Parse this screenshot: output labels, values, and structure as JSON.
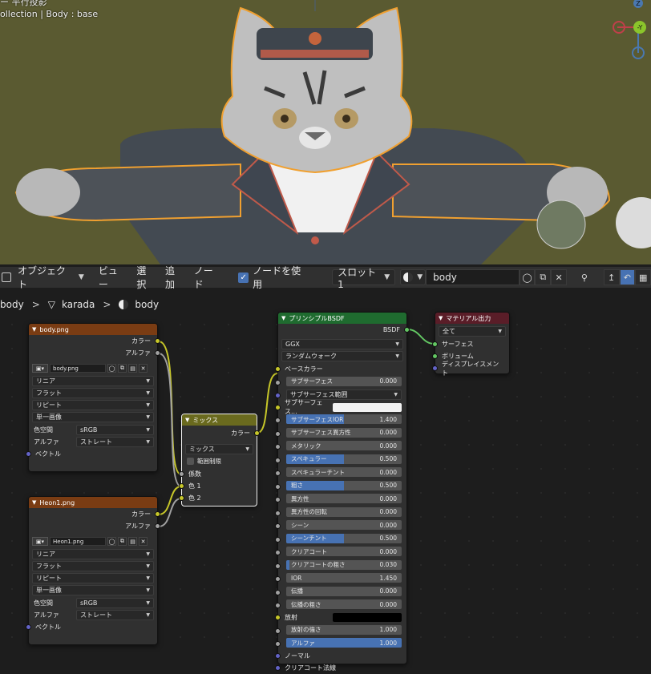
{
  "viewport": {
    "line1": "ー 平行投影",
    "line2": "ollection | Body : base",
    "gizmo": {
      "z": "Z",
      "y": "-Y"
    }
  },
  "header": {
    "mode_label": "オブジェクト",
    "menu": [
      "ビュー",
      "選択",
      "追加",
      "ノード"
    ],
    "use_nodes_label": "ノードを使用",
    "slot_label": "スロット1",
    "material_name": "body"
  },
  "breadcrumb": {
    "items": [
      "body",
      "karada",
      "body"
    ]
  },
  "colors": {
    "texture_header": "#7a3c13",
    "mix_header": "#6a6a1e",
    "shader_header": "#1f6b2f",
    "output_header": "#5a1d28",
    "accent": "#4772b3"
  },
  "nodes": {
    "body_png": {
      "title": "body.png",
      "outputs": [
        "カラー",
        "アルファ"
      ],
      "image": "body.png",
      "selects": [
        "リニア",
        "フラット",
        "リピート",
        "単一画像"
      ],
      "colorspace_label": "色空間",
      "colorspace": "sRGB",
      "alpha_label": "アルファ",
      "alpha": "ストレート",
      "input": "ベクトル"
    },
    "heon_png": {
      "title": "Heon1.png",
      "outputs": [
        "カラー",
        "アルファ"
      ],
      "image": "Heon1.png",
      "selects": [
        "リニア",
        "フラット",
        "リピート",
        "単一画像"
      ],
      "colorspace_label": "色空間",
      "colorspace": "sRGB",
      "alpha_label": "アルファ",
      "alpha": "ストレート",
      "input": "ベクトル"
    },
    "mix": {
      "title": "ミックス",
      "output": "カラー",
      "blend": "ミックス",
      "clamp": "範囲制限",
      "inputs": [
        "係数",
        "色 1",
        "色 2"
      ]
    },
    "bsdf": {
      "title": "プリンシプルBSDF",
      "output": "BSDF",
      "distribution": "GGX",
      "subsurface_method": "ランダムウォーク",
      "base_color": "ベースカラー",
      "ss_range": "サブサーフェス範囲",
      "ss_color": "サブサーフェス...",
      "emission": "放射",
      "normal": "ノーマル",
      "clearcoat_normal": "クリアコート法線",
      "sliders_a": [
        {
          "label": "サブサーフェス",
          "value": "0.000",
          "fill": 0
        }
      ],
      "sliders_b": [
        {
          "label": "サブサーフェスIOR",
          "value": "1.400",
          "fill": 0.5
        },
        {
          "label": "サブサーフェス異方性",
          "value": "0.000",
          "fill": 0
        },
        {
          "label": "メタリック",
          "value": "0.000",
          "fill": 0
        },
        {
          "label": "スペキュラー",
          "value": "0.500",
          "fill": 0.5
        },
        {
          "label": "スペキュラーチント",
          "value": "0.000",
          "fill": 0
        },
        {
          "label": "粗さ",
          "value": "0.500",
          "fill": 0.5
        },
        {
          "label": "異方性",
          "value": "0.000",
          "fill": 0
        },
        {
          "label": "異方性の回転",
          "value": "0.000",
          "fill": 0
        },
        {
          "label": "シーン",
          "value": "0.000",
          "fill": 0
        },
        {
          "label": "シーンチント",
          "value": "0.500",
          "fill": 0.5
        },
        {
          "label": "クリアコート",
          "value": "0.000",
          "fill": 0
        },
        {
          "label": "クリアコートの粗さ",
          "value": "0.030",
          "fill": 0.03
        },
        {
          "label": "IOR",
          "value": "1.450",
          "fill": 0
        },
        {
          "label": "伝播",
          "value": "0.000",
          "fill": 0
        },
        {
          "label": "伝播の粗さ",
          "value": "0.000",
          "fill": 0
        }
      ],
      "sliders_c": [
        {
          "label": "放射の強さ",
          "value": "1.000",
          "fill": 0
        },
        {
          "label": "アルファ",
          "value": "1.000",
          "fill": 1
        }
      ]
    },
    "output": {
      "title": "マテリアル出力",
      "target": "全て",
      "inputs": [
        "サーフェス",
        "ボリューム",
        "ディスプレイスメント"
      ]
    }
  }
}
